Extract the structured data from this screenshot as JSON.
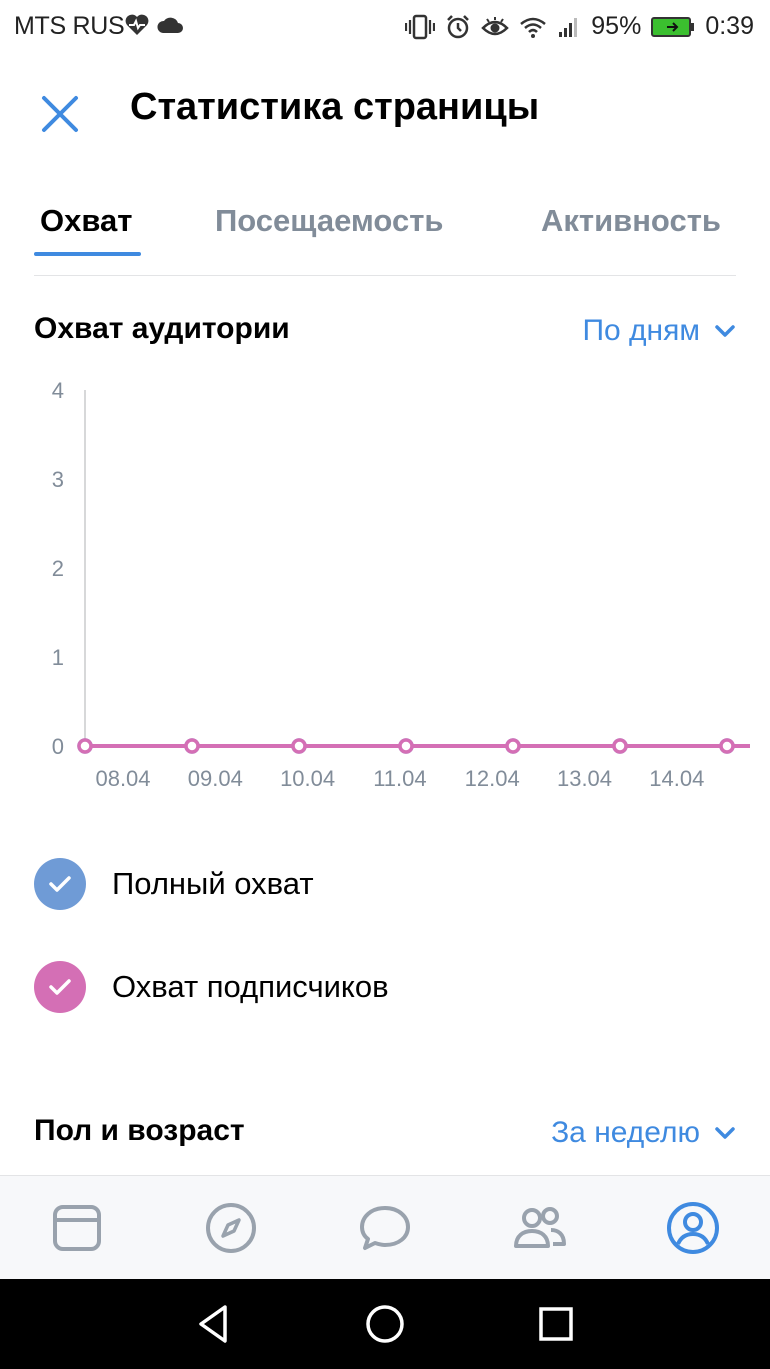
{
  "status_bar": {
    "carrier": "MTS RUS",
    "battery": "95%",
    "time": "0:39",
    "icons": [
      "heartbeat-icon",
      "cloud-icon",
      "vibrate-icon",
      "alarm-icon",
      "eye-icon",
      "wifi-icon",
      "signal-icon",
      "battery-icon"
    ]
  },
  "header": {
    "title": "Статистика страницы",
    "close_icon": "close-icon"
  },
  "tabs": [
    {
      "label": "Охват",
      "active": true
    },
    {
      "label": "Посещаемость",
      "active": false
    },
    {
      "label": "Активность",
      "active": false
    }
  ],
  "reach_section": {
    "title": "Охват аудитории",
    "period": "По дням"
  },
  "chart_data": {
    "type": "line",
    "categories": [
      "08.04",
      "09.04",
      "10.04",
      "11.04",
      "12.04",
      "13.04",
      "14.04"
    ],
    "series": [
      {
        "name": "Полный охват",
        "color": "#6f9bd6",
        "values": [
          0,
          0,
          0,
          0,
          0,
          0,
          0
        ]
      },
      {
        "name": "Охват подписчиков",
        "color": "#d46fb5",
        "values": [
          0,
          0,
          0,
          0,
          0,
          0,
          0
        ]
      }
    ],
    "ylim": [
      0,
      4
    ],
    "yticks": [
      0,
      1,
      2,
      3,
      4
    ],
    "grid": false
  },
  "legend": [
    {
      "label": "Полный охват",
      "color": "#6f9bd6",
      "checked": true
    },
    {
      "label": "Охват подписчиков",
      "color": "#d46fb5",
      "checked": true
    }
  ],
  "gender_section": {
    "title": "Пол и возраст",
    "period": "За неделю"
  },
  "bottom_nav": [
    {
      "icon": "news-icon",
      "active": false
    },
    {
      "icon": "explore-compass-icon",
      "active": false
    },
    {
      "icon": "messages-icon",
      "active": false
    },
    {
      "icon": "friends-icon",
      "active": false
    },
    {
      "icon": "profile-icon",
      "active": true
    }
  ],
  "colors": {
    "accent": "#3f8ae0",
    "inactive": "#818c99",
    "series_total": "#6f9bd6",
    "series_subscribers": "#d46fb5"
  }
}
